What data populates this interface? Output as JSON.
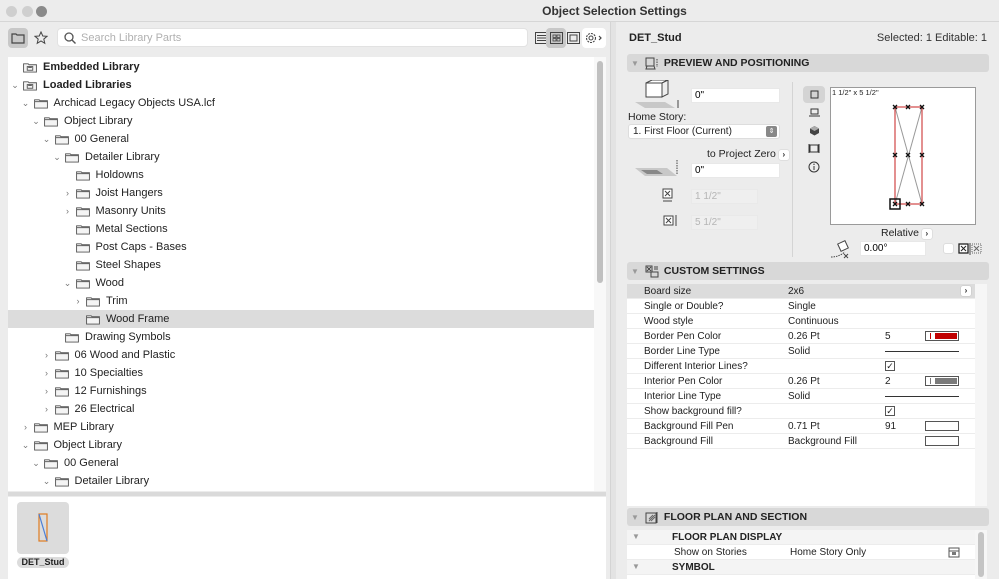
{
  "window": {
    "title": "Object Selection Settings"
  },
  "toolbar": {
    "folder_view": "folder-icon",
    "favorites": "star-icon",
    "search_placeholder": "Search Library Parts",
    "search_value": "",
    "view_list": "list-view-icon",
    "view_grid": "grid-view-icon",
    "view_preview": "preview-view-icon",
    "settings": "gear-icon"
  },
  "tree": {
    "items": [
      {
        "label": "Embedded Library",
        "level": 0,
        "bold": true,
        "expander": "none",
        "icon": "library"
      },
      {
        "label": "Loaded Libraries",
        "level": 0,
        "bold": true,
        "expander": "open",
        "icon": "library"
      },
      {
        "label": "Archicad Legacy Objects USA.lcf",
        "level": 1,
        "expander": "open",
        "icon": "folder"
      },
      {
        "label": "Object Library",
        "level": 2,
        "expander": "open",
        "icon": "folder"
      },
      {
        "label": "00 General",
        "level": 3,
        "expander": "open",
        "icon": "folder"
      },
      {
        "label": "Detailer Library",
        "level": 4,
        "expander": "open",
        "icon": "folder"
      },
      {
        "label": "Holdowns",
        "level": 5,
        "expander": "none",
        "icon": "folder"
      },
      {
        "label": "Joist Hangers",
        "level": 5,
        "expander": "closed",
        "icon": "folder"
      },
      {
        "label": "Masonry Units",
        "level": 5,
        "expander": "closed",
        "icon": "folder"
      },
      {
        "label": "Metal Sections",
        "level": 5,
        "expander": "none",
        "icon": "folder"
      },
      {
        "label": "Post Caps - Bases",
        "level": 5,
        "expander": "none",
        "icon": "folder"
      },
      {
        "label": "Steel Shapes",
        "level": 5,
        "expander": "none",
        "icon": "folder"
      },
      {
        "label": "Wood",
        "level": 5,
        "expander": "open",
        "icon": "folder"
      },
      {
        "label": "Trim",
        "level": 6,
        "expander": "closed",
        "icon": "folder"
      },
      {
        "label": "Wood Frame",
        "level": 6,
        "expander": "none",
        "icon": "folder",
        "selected": true
      },
      {
        "label": "Drawing Symbols",
        "level": 4,
        "expander": "none",
        "icon": "folder"
      },
      {
        "label": "06 Wood and Plastic",
        "level": 3,
        "expander": "closed",
        "icon": "folder"
      },
      {
        "label": "10 Specialties",
        "level": 3,
        "expander": "closed",
        "icon": "folder"
      },
      {
        "label": "12 Furnishings",
        "level": 3,
        "expander": "closed",
        "icon": "folder"
      },
      {
        "label": "26 Electrical",
        "level": 3,
        "expander": "closed",
        "icon": "folder"
      },
      {
        "label": "MEP Library",
        "level": 1,
        "expander": "closed",
        "icon": "folder"
      },
      {
        "label": "Object Library",
        "level": 1,
        "expander": "open",
        "icon": "folder"
      },
      {
        "label": "00 General",
        "level": 2,
        "expander": "open",
        "icon": "folder"
      },
      {
        "label": "Detailer Library",
        "level": 3,
        "expander": "open",
        "icon": "folder"
      }
    ]
  },
  "preview_strip": {
    "items": [
      {
        "name": "DET_Stud"
      }
    ]
  },
  "settings_header": {
    "object_name": "DET_Stud",
    "selection_info": "Selected: 1 Editable: 1"
  },
  "preview_positioning": {
    "title": "PREVIEW AND POSITIONING",
    "elevation_value": "0\"",
    "home_story_label": "Home Story:",
    "home_story_value": "1. First Floor (Current)",
    "reference_label": "to Project Zero",
    "project_zero_value": "0\"",
    "width_value": "1 1/2\"",
    "depth_value": "5 1/2\"",
    "canvas_dimensions": "1 1/2\" x 5 1/2\"",
    "relative_label": "Relative",
    "rotation_value": "0.00°"
  },
  "custom_settings": {
    "title": "CUSTOM SETTINGS",
    "rows": [
      {
        "name": "Board size",
        "value": "2x6",
        "extra": "",
        "control": "arrow"
      },
      {
        "name": "Single or Double?",
        "value": "Single",
        "extra": "",
        "control": "none"
      },
      {
        "name": "Wood style",
        "value": "Continuous",
        "extra": "",
        "control": "none"
      },
      {
        "name": "Border Pen Color",
        "value": "0.26 Pt",
        "extra": "5",
        "control": "pen",
        "color": "#c00000"
      },
      {
        "name": "Border Line Type",
        "value": "Solid",
        "extra": "",
        "control": "line"
      },
      {
        "name": "Different Interior Lines?",
        "value": "",
        "extra": "",
        "control": "check",
        "checked": true
      },
      {
        "name": "Interior Pen Color",
        "value": "0.26 Pt",
        "extra": "2",
        "control": "pen",
        "color": "#7a7a7a"
      },
      {
        "name": "Interior Line Type",
        "value": "Solid",
        "extra": "",
        "control": "line"
      },
      {
        "name": "Show background fill?",
        "value": "",
        "extra": "",
        "control": "check",
        "checked": true
      },
      {
        "name": "Background Fill Pen",
        "value": "0.71 Pt",
        "extra": "91",
        "control": "emptybox"
      },
      {
        "name": "Background Fill",
        "value": "Background Fill",
        "extra": "",
        "control": "emptybox"
      }
    ]
  },
  "floor_plan": {
    "title": "FLOOR PLAN AND SECTION",
    "groups": [
      {
        "title": "FLOOR PLAN DISPLAY"
      },
      {
        "title": "SYMBOL"
      }
    ],
    "show_on_stories_label": "Show on Stories",
    "show_on_stories_value": "Home Story Only"
  }
}
